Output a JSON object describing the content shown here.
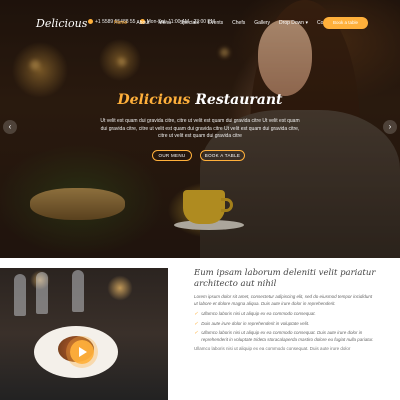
{
  "brand": {
    "logo": "Delicious",
    "accent": "#ffb03b"
  },
  "topbar": {
    "phone": "+1 5589 55488 55",
    "hours": "Mon-Sat: 11:00 AM - 23:00 PM"
  },
  "nav": {
    "items": [
      "Home",
      "About",
      "Menu",
      "Specials",
      "Events",
      "Chefs",
      "Gallery",
      "Drop Down",
      "Contact"
    ],
    "active": "Home",
    "book_label": "Book a table"
  },
  "hero": {
    "title_part1": "Delicious",
    "title_part2": "Restaurant",
    "text": "Ut velit est quam dui gravida citre, citre ut velit est quam dui gravida citre Ut velit est quam dui gravida citre, citre ut velit est quam dui gravida citre Ut velit est quam dui gravida citre, citre ut velit est quam dui gravida citre",
    "btn_menu": "OUR MENU",
    "btn_book": "BOOK A TABLE",
    "prev": "‹",
    "next": "›"
  },
  "about": {
    "title": "Eum ipsam laborum deleniti velit pariatur architecto aut nihil",
    "intro": "Lorem ipsum dolor sit amet, consectetur adipiscing elit, sed do eiusmod tempor incididunt ut labore et dolore magna aliqua. Duis aute irure dolor in reprehenderit.",
    "checks": [
      "Ullamco laboris nisi ut aliquip ex ea commodo consequat.",
      "Duis aute irure dolor in reprehenderit in voluptate velit.",
      "Ullamco laboris nisi ut aliquip ex ea commodo consequat. Duis aute irure dolor in reprehenderit in voluptate trideta storacalaperda mastiro dolore eu fugiat nulla pariatur."
    ],
    "footer": "Ullamco laboris nisi ut aliquip ex ea commodo consequat. Duis aute irure dolor"
  }
}
